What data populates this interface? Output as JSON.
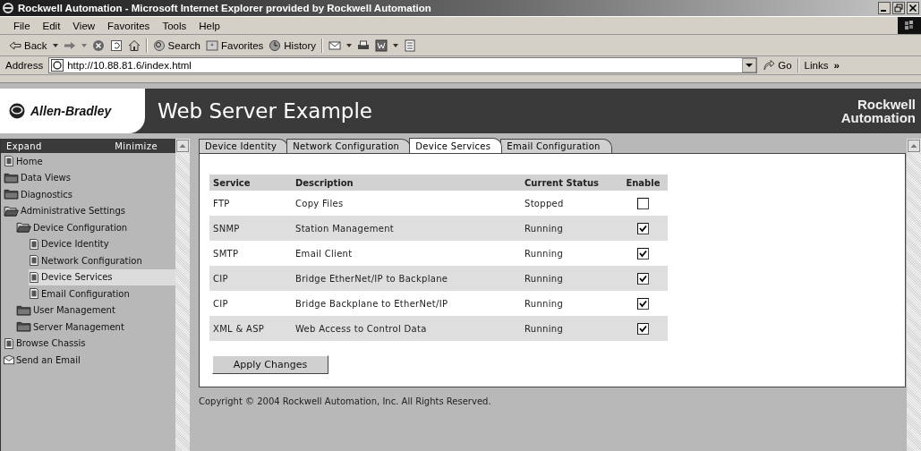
{
  "window": {
    "title": "Rockwell Automation - Microsoft Internet Explorer provided by Rockwell Automation"
  },
  "menu": [
    "File",
    "Edit",
    "View",
    "Favorites",
    "Tools",
    "Help"
  ],
  "toolbar": {
    "back": "Back",
    "search": "Search",
    "favorites": "Favorites",
    "history": "History"
  },
  "address": {
    "label": "Address",
    "url": "http://10.88.81.6/index.html",
    "go": "Go",
    "links": "Links",
    "more": "»"
  },
  "banner": {
    "brand": "Allen-Bradley",
    "title": "Web Server Example",
    "company_line_1": "Rockwell",
    "company_line_2": "Automation"
  },
  "sidebar": {
    "expand": "Expand",
    "minimize": "Minimize",
    "tree": [
      {
        "label": "Home",
        "kind": "page",
        "selected": false
      },
      {
        "label": "Data Views",
        "kind": "folder",
        "expanded": false,
        "selected": false
      },
      {
        "label": "Diagnostics",
        "kind": "folder",
        "expanded": false,
        "selected": false
      },
      {
        "label": "Administrative Settings",
        "kind": "folder",
        "expanded": true,
        "selected": false,
        "children": [
          {
            "label": "Device Configuration",
            "kind": "folder",
            "expanded": true,
            "selected": false,
            "children": [
              {
                "label": "Device Identity",
                "kind": "page",
                "selected": false
              },
              {
                "label": "Network Configuration",
                "kind": "page",
                "selected": false
              },
              {
                "label": "Device Services",
                "kind": "page",
                "selected": true
              },
              {
                "label": "Email Configuration",
                "kind": "page",
                "selected": false
              }
            ]
          },
          {
            "label": "User Management",
            "kind": "folder",
            "expanded": false,
            "selected": false
          },
          {
            "label": "Server Management",
            "kind": "folder",
            "expanded": false,
            "selected": false
          }
        ]
      },
      {
        "label": "Browse Chassis",
        "kind": "page",
        "selected": false
      },
      {
        "label": "Send an Email",
        "kind": "mail",
        "selected": false
      }
    ]
  },
  "tabs": [
    {
      "label": "Device Identity",
      "selected": false
    },
    {
      "label": "Network Configuration",
      "selected": false
    },
    {
      "label": "Device Services",
      "selected": true
    },
    {
      "label": "Email Configuration",
      "selected": false
    }
  ],
  "table": {
    "columns": [
      "Service",
      "Description",
      "Current Status",
      "Enable"
    ],
    "rows": [
      {
        "service": "FTP",
        "description": "Copy Files",
        "status": "Stopped",
        "enabled": false
      },
      {
        "service": "SNMP",
        "description": "Station Management",
        "status": "Running",
        "enabled": true
      },
      {
        "service": "SMTP",
        "description": "Email Client",
        "status": "Running",
        "enabled": true
      },
      {
        "service": "CIP",
        "description": "Bridge EtherNet/IP to Backplane",
        "status": "Running",
        "enabled": true
      },
      {
        "service": "CIP",
        "description": "Bridge Backplane to EtherNet/IP",
        "status": "Running",
        "enabled": true
      },
      {
        "service": "XML & ASP",
        "description": "Web Access to Control Data",
        "status": "Running",
        "enabled": true
      }
    ]
  },
  "apply_button": "Apply Changes",
  "copyright": "Copyright © 2004 Rockwell Automation, Inc. All Rights Reserved."
}
